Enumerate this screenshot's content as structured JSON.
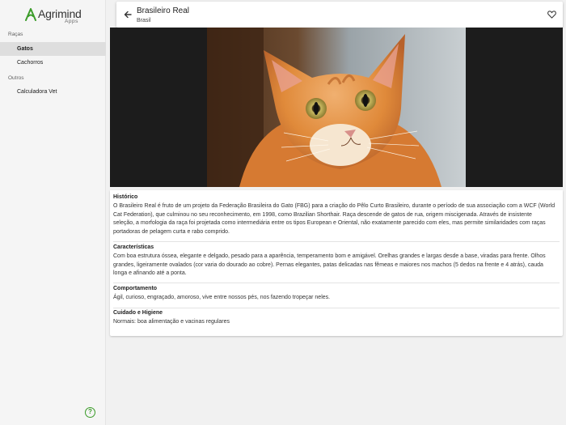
{
  "app": {
    "logo_name": "Agrimind",
    "logo_sub": "Apps",
    "brand_color": "#3c9c2a"
  },
  "sidebar": {
    "section1": "Raças",
    "items1": [
      {
        "label": "Gatos",
        "active": true
      },
      {
        "label": "Cachorros",
        "active": false
      }
    ],
    "section2": "Outros",
    "items2": [
      {
        "label": "Calculadora Vet",
        "active": false
      }
    ],
    "help_icon": "help-circle-icon"
  },
  "header": {
    "title": "Brasileiro Real",
    "subtitle": "Brasil",
    "back_icon": "arrow-back-icon",
    "favorite_icon": "heart-outline-icon"
  },
  "details": {
    "sections": [
      {
        "title": "Histórico",
        "lines": [
          "O Brasileiro Real é fruto de um projeto da Federação Brasileira do Gato (FBG) para a criação do Pêlo Curto Brasileiro, durante o período de sua associação com a WCF (World",
          "Cat Federation), que culminou no seu reconhecimento, em 1998, como Brazilian Shorthair. Raça descende de gatos de rua, origem miscigenada. Através de insistente",
          "seleção, a morfologia da raça foi projetada como intermediária entre os tipos European e Oriental, não exatamente parecido com eles, mas permite similaridades com raças",
          "portadoras de pelagem curta e rabo comprido."
        ]
      },
      {
        "title": "Características",
        "lines": [
          "Com boa estrutura óssea, elegante e delgado, pesado para a aparência, temperamento bom e amigável. Orelhas grandes e largas desde a base, viradas para frente. Olhos",
          "grandes, ligeiramente ovalados (cor varia do dourado ao cobre). Pernas elegantes, patas delicadas nas fêmeas e maiores nos machos (5 dedos na frente e 4 atrás), cauda",
          "longa e afinando até a ponta."
        ]
      },
      {
        "title": "Comportamento",
        "lines": [
          "Ágil, curioso, engraçado, amoroso, vive entre nossos pés, nos fazendo tropeçar neles."
        ]
      },
      {
        "title": "Cuidado e Higiene",
        "lines": [
          "Normais: boa alimentação e vacinas regulares"
        ]
      }
    ]
  }
}
